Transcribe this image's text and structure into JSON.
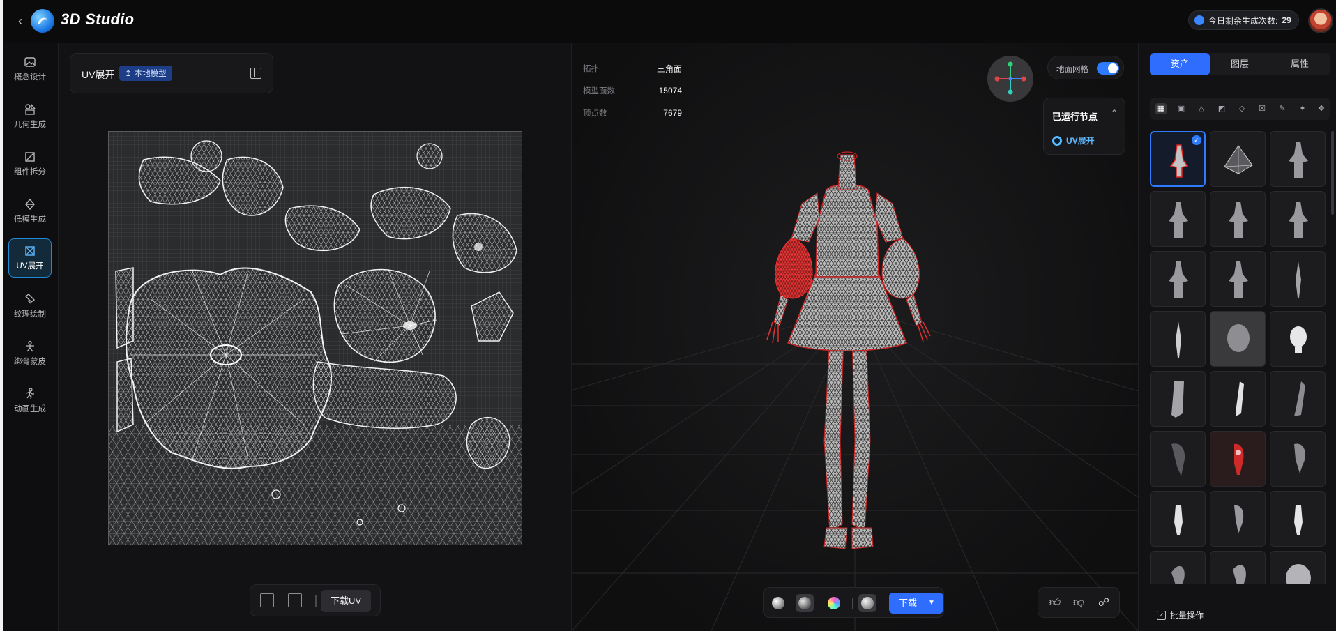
{
  "app": {
    "title": "3D Studio"
  },
  "quota": {
    "label": "今日剩余生成次数:",
    "value": "29"
  },
  "sidebar": {
    "items": [
      {
        "label": "概念设计",
        "icon": "image-icon"
      },
      {
        "label": "几何生成",
        "icon": "shapes-icon"
      },
      {
        "label": "组件拆分",
        "icon": "split-icon"
      },
      {
        "label": "低模生成",
        "icon": "lowpoly-icon"
      },
      {
        "label": "UV展开",
        "icon": "uv-icon",
        "active": true
      },
      {
        "label": "纹理绘制",
        "icon": "texture-icon"
      },
      {
        "label": "绑骨蒙皮",
        "icon": "rig-icon"
      },
      {
        "label": "动画生成",
        "icon": "run-icon"
      }
    ]
  },
  "uv_panel": {
    "title": "UV展开",
    "badge": "本地模型",
    "download_label": "下载UV"
  },
  "viewport": {
    "stats": [
      {
        "label": "拓扑",
        "value": "三角面"
      },
      {
        "label": "模型面数",
        "value": "15074"
      },
      {
        "label": "顶点数",
        "value": "7679"
      }
    ],
    "grid_toggle_label": "地面网格",
    "grid_toggle_on": true,
    "nodes_title": "已运行节点",
    "node_item": "UV展开",
    "download_label": "下载",
    "accent_color": "#2f6dff"
  },
  "right_panel": {
    "tabs": [
      "资产",
      "图层",
      "属性"
    ],
    "active_tab": "资产",
    "batch_label": "批量操作"
  }
}
